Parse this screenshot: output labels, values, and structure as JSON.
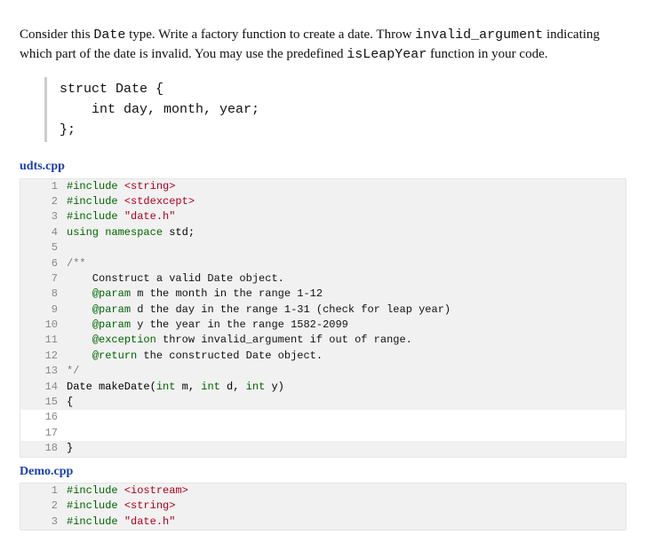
{
  "intro": {
    "part1": "Consider this ",
    "code1": "Date",
    "part2": " type. Write a factory function to create a date. Throw ",
    "code2": "invalid_argument",
    "part3": " indicating which part of the date is invalid. You may use the predefined ",
    "code3": "isLeapYear",
    "part4": " function in your code."
  },
  "snippet": "struct Date {\n    int day, month, year;\n};",
  "files": [
    {
      "name": "udts.cpp",
      "lines": [
        {
          "n": 1,
          "blank": false,
          "tokens": [
            [
              "kw",
              "#include "
            ],
            [
              "hdr",
              "<string>"
            ]
          ]
        },
        {
          "n": 2,
          "blank": false,
          "tokens": [
            [
              "kw",
              "#include "
            ],
            [
              "hdr",
              "<stdexcept>"
            ]
          ]
        },
        {
          "n": 3,
          "blank": false,
          "tokens": [
            [
              "kw",
              "#include "
            ],
            [
              "hdr",
              "\"date.h\""
            ]
          ]
        },
        {
          "n": 4,
          "blank": false,
          "tokens": [
            [
              "kw",
              "using namespace"
            ],
            [
              "pl",
              " std;"
            ]
          ]
        },
        {
          "n": 5,
          "blank": false,
          "tokens": [
            [
              "pl",
              ""
            ]
          ]
        },
        {
          "n": 6,
          "blank": false,
          "tokens": [
            [
              "cmt",
              "/**"
            ]
          ]
        },
        {
          "n": 7,
          "blank": false,
          "tokens": [
            [
              "doc",
              "    Construct a valid Date object."
            ]
          ]
        },
        {
          "n": 8,
          "blank": false,
          "tokens": [
            [
              "doc",
              "    "
            ],
            [
              "tag",
              "@param"
            ],
            [
              "doc",
              " m "
            ],
            [
              "doc",
              "the month in the range 1-12"
            ]
          ]
        },
        {
          "n": 9,
          "blank": false,
          "tokens": [
            [
              "doc",
              "    "
            ],
            [
              "tag",
              "@param"
            ],
            [
              "doc",
              " d "
            ],
            [
              "doc",
              "the day in the range 1-31 (check for leap year)"
            ]
          ]
        },
        {
          "n": 10,
          "blank": false,
          "tokens": [
            [
              "doc",
              "    "
            ],
            [
              "tag",
              "@param"
            ],
            [
              "doc",
              " y "
            ],
            [
              "doc",
              "the year in the range 1582-2099"
            ]
          ]
        },
        {
          "n": 11,
          "blank": false,
          "tokens": [
            [
              "doc",
              "    "
            ],
            [
              "tag",
              "@exception"
            ],
            [
              "doc",
              " throw invalid_argument if out of range."
            ]
          ]
        },
        {
          "n": 12,
          "blank": false,
          "tokens": [
            [
              "doc",
              "    "
            ],
            [
              "tag",
              "@return"
            ],
            [
              "doc",
              " the constructed Date object."
            ]
          ]
        },
        {
          "n": 13,
          "blank": false,
          "tokens": [
            [
              "cmt",
              "*/"
            ]
          ]
        },
        {
          "n": 14,
          "blank": false,
          "tokens": [
            [
              "pl",
              "Date makeDate("
            ],
            [
              "kw",
              "int"
            ],
            [
              "pl",
              " m, "
            ],
            [
              "kw",
              "int"
            ],
            [
              "pl",
              " d, "
            ],
            [
              "kw",
              "int"
            ],
            [
              "pl",
              " y)"
            ]
          ]
        },
        {
          "n": 15,
          "blank": false,
          "tokens": [
            [
              "pl",
              "{"
            ]
          ]
        },
        {
          "n": 16,
          "blank": true,
          "tokens": [
            [
              "pl",
              ""
            ]
          ]
        },
        {
          "n": 17,
          "blank": true,
          "tokens": [
            [
              "pl",
              ""
            ]
          ]
        },
        {
          "n": 18,
          "blank": false,
          "tokens": [
            [
              "pl",
              "}"
            ]
          ]
        }
      ]
    },
    {
      "name": "Demo.cpp",
      "lines": [
        {
          "n": 1,
          "blank": false,
          "tokens": [
            [
              "kw",
              "#include "
            ],
            [
              "hdr",
              "<iostream>"
            ]
          ]
        },
        {
          "n": 2,
          "blank": false,
          "tokens": [
            [
              "kw",
              "#include "
            ],
            [
              "hdr",
              "<string>"
            ]
          ]
        },
        {
          "n": 3,
          "blank": false,
          "tokens": [
            [
              "kw",
              "#include "
            ],
            [
              "hdr",
              "\"date.h\""
            ]
          ]
        }
      ]
    }
  ]
}
